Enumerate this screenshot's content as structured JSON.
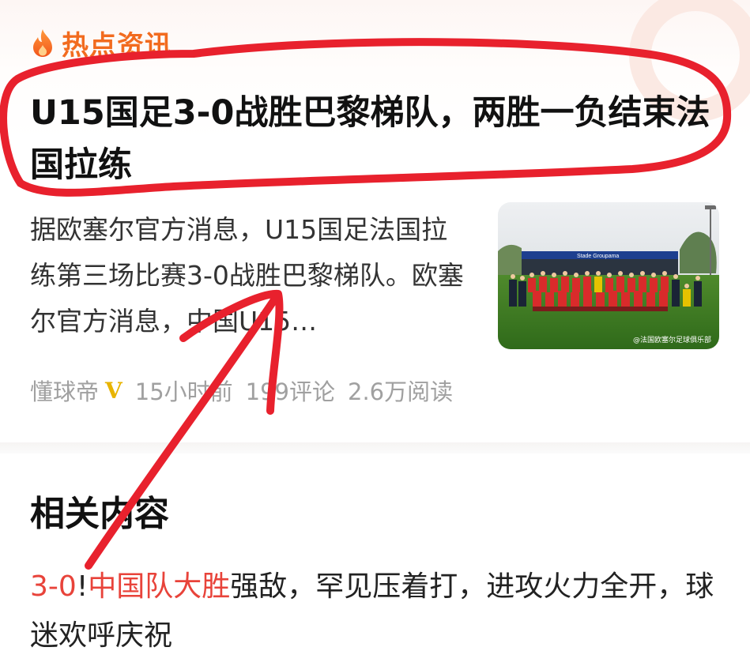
{
  "hot_news": {
    "section_title": "热点资讯",
    "section_icon": "flame-icon",
    "headline": "U15国足3-0战胜巴黎梯队，两胜一负结束法国拉练",
    "summary": "据欧塞尔官方消息，U15国足法国拉练第三场比赛3-0战胜巴黎梯队。欧塞尔官方消息，中国U15…",
    "thumbnail": {
      "stadium_sign": "Stade Groupama",
      "watermark": "@法国欧塞尔足球俱乐部"
    },
    "meta": {
      "author": "懂球帝",
      "verified_mark": "V",
      "time": "15小时前",
      "comments": "199评论",
      "reads": "2.6万阅读"
    }
  },
  "related": {
    "title": "相关内容",
    "item": {
      "highlight_score": "3-0",
      "exclamation": "!",
      "highlight_team": "中国队大胜",
      "rest": "强敌，罕见压着打，进攻火力全开，球迷欢呼庆祝"
    }
  },
  "colors": {
    "accent": "#f26b1f",
    "highlight": "#e8433a",
    "annotation": "#e8212d"
  }
}
